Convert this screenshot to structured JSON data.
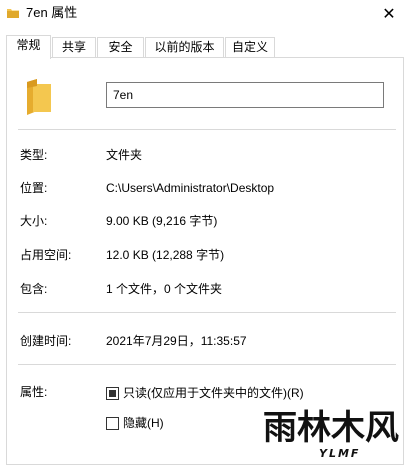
{
  "window": {
    "title": "7en 属性",
    "close_glyph": "✕"
  },
  "tabs": [
    {
      "label": "常规",
      "active": true
    },
    {
      "label": "共享"
    },
    {
      "label": "安全"
    },
    {
      "label": "以前的版本"
    },
    {
      "label": "自定义"
    }
  ],
  "general": {
    "name_value": "7en",
    "fields": {
      "type": {
        "label": "类型:",
        "value": "文件夹"
      },
      "location": {
        "label": "位置:",
        "value": "C:\\Users\\Administrator\\Desktop"
      },
      "size": {
        "label": "大小:",
        "value": "9.00 KB (9,216 字节)"
      },
      "size_on_disk": {
        "label": "占用空间:",
        "value": "12.0 KB (12,288 字节)"
      },
      "contains": {
        "label": "包含:",
        "value": "1 个文件，0 个文件夹"
      },
      "created": {
        "label": "创建时间:",
        "value": "2021年7月29日，11:35:57"
      }
    },
    "attributes": {
      "label": "属性:",
      "readonly": {
        "label": "只读(仅应用于文件夹中的文件)(R)",
        "checked": "indeterminate"
      },
      "hidden": {
        "label": "隐藏(H)",
        "checked": false
      }
    }
  },
  "watermark": {
    "text": "雨林木风",
    "subtext": "YLMF"
  },
  "colors": {
    "folder": "#f3c44f",
    "folder_dark": "#e0a92c",
    "border": "#d9d9d9"
  }
}
